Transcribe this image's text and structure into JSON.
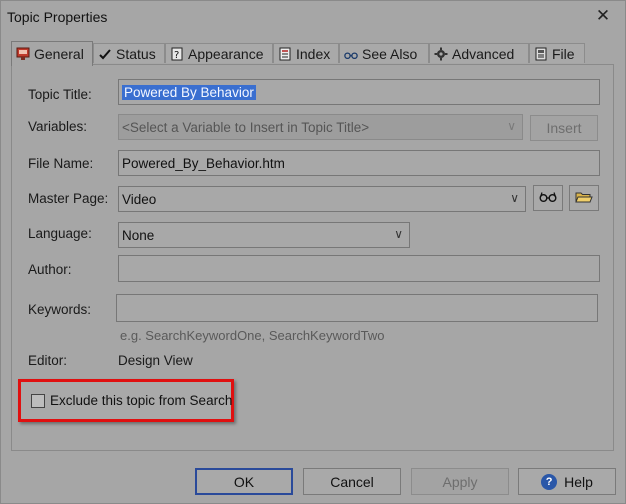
{
  "window": {
    "title": "Topic Properties",
    "close_symbol": "✕"
  },
  "tabs": [
    {
      "label": "General",
      "icon": "general-tab-icon",
      "active": true
    },
    {
      "label": "Status",
      "icon": "checkmark-icon"
    },
    {
      "label": "Appearance",
      "icon": "question-doc-icon"
    },
    {
      "label": "Index",
      "icon": "index-list-icon"
    },
    {
      "label": "See Also",
      "icon": "glasses-icon"
    },
    {
      "label": "Advanced",
      "icon": "gear-icon"
    },
    {
      "label": "File",
      "icon": "file-icon"
    }
  ],
  "form": {
    "topic_title_label": "Topic Title:",
    "topic_title_value": "Powered By Behavior",
    "variables_label": "Variables:",
    "variables_value": "<Select a Variable to Insert in Topic Title>",
    "insert_label": "Insert",
    "file_name_label": "File Name:",
    "file_name_value": "Powered_By_Behavior.htm",
    "master_page_label": "Master Page:",
    "master_page_value": "Video",
    "language_label": "Language:",
    "language_value": "None",
    "author_label": "Author:",
    "author_value": "",
    "keywords_label": "Keywords:",
    "keywords_value": "",
    "keywords_hint": "e.g. SearchKeywordOne, SearchKeywordTwo",
    "editor_label": "Editor:",
    "editor_value": "Design View",
    "exclude_label": "Exclude this topic from Search",
    "exclude_checked": false
  },
  "buttons": {
    "ok": "OK",
    "cancel": "Cancel",
    "apply": "Apply",
    "help": "Help"
  },
  "colors": {
    "highlight_border": "#e01010",
    "selection": "#3a6fd0",
    "default_button_border": "#2a4a9a"
  }
}
